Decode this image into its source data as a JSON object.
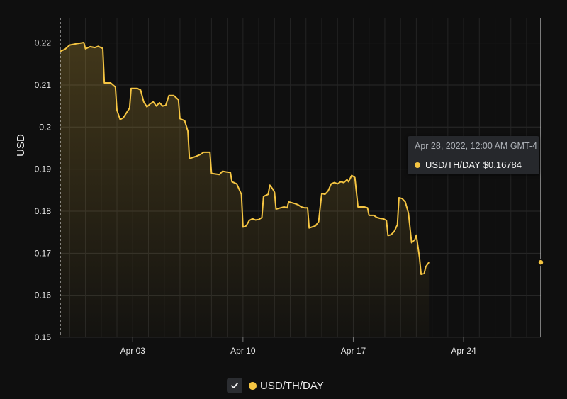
{
  "chart_data": {
    "type": "area",
    "ylabel": "USD",
    "xlabel": "",
    "ylim": [
      0.15,
      0.226
    ],
    "y_ticks": [
      "0.15",
      "0.16",
      "0.17",
      "0.18",
      "0.19",
      "0.2",
      "0.21",
      "0.22"
    ],
    "x_ticks": [
      {
        "label": "Apr 03",
        "x": 6
      },
      {
        "label": "Apr 10",
        "x": 13
      },
      {
        "label": "Apr 17",
        "x": 20
      },
      {
        "label": "Apr 24",
        "x": 27
      }
    ],
    "xlim": [
      1.4,
      31.9
    ],
    "grid": true,
    "series": [
      {
        "name": "USD/TH/DAY",
        "color": "#f5c542",
        "points": [
          [
            1.4,
            0.218
          ],
          [
            1.7,
            0.2185
          ],
          [
            2.0,
            0.2195
          ],
          [
            2.4,
            0.2198
          ],
          [
            2.9,
            0.2201
          ],
          [
            3.0,
            0.2186
          ],
          [
            3.3,
            0.2191
          ],
          [
            3.6,
            0.2189
          ],
          [
            3.8,
            0.2192
          ],
          [
            4.1,
            0.2187
          ],
          [
            4.2,
            0.2105
          ],
          [
            4.6,
            0.2105
          ],
          [
            4.9,
            0.2095
          ],
          [
            5.0,
            0.204
          ],
          [
            5.2,
            0.2018
          ],
          [
            5.4,
            0.2022
          ],
          [
            5.8,
            0.2045
          ],
          [
            5.9,
            0.2092
          ],
          [
            6.3,
            0.2092
          ],
          [
            6.5,
            0.2088
          ],
          [
            6.7,
            0.206
          ],
          [
            6.9,
            0.2048
          ],
          [
            7.1,
            0.2055
          ],
          [
            7.3,
            0.206
          ],
          [
            7.5,
            0.205
          ],
          [
            7.7,
            0.2058
          ],
          [
            7.9,
            0.205
          ],
          [
            8.1,
            0.2052
          ],
          [
            8.3,
            0.2075
          ],
          [
            8.6,
            0.2075
          ],
          [
            8.9,
            0.2065
          ],
          [
            9.0,
            0.202
          ],
          [
            9.3,
            0.2015
          ],
          [
            9.5,
            0.199
          ],
          [
            9.6,
            0.1925
          ],
          [
            10.0,
            0.193
          ],
          [
            10.3,
            0.1935
          ],
          [
            10.5,
            0.194
          ],
          [
            10.9,
            0.194
          ],
          [
            11.0,
            0.189
          ],
          [
            11.5,
            0.1887
          ],
          [
            11.7,
            0.1895
          ],
          [
            12.0,
            0.1893
          ],
          [
            12.2,
            0.1892
          ],
          [
            12.3,
            0.187
          ],
          [
            12.6,
            0.1865
          ],
          [
            12.9,
            0.184
          ],
          [
            13.0,
            0.1762
          ],
          [
            13.2,
            0.1765
          ],
          [
            13.4,
            0.1778
          ],
          [
            13.6,
            0.1782
          ],
          [
            13.8,
            0.1779
          ],
          [
            14.0,
            0.178
          ],
          [
            14.2,
            0.1785
          ],
          [
            14.3,
            0.1835
          ],
          [
            14.6,
            0.184
          ],
          [
            14.7,
            0.1862
          ],
          [
            14.9,
            0.1852
          ],
          [
            15.0,
            0.1845
          ],
          [
            15.1,
            0.1805
          ],
          [
            15.4,
            0.1808
          ],
          [
            15.6,
            0.181
          ],
          [
            15.8,
            0.1808
          ],
          [
            15.9,
            0.1822
          ],
          [
            16.3,
            0.1818
          ],
          [
            16.5,
            0.1815
          ],
          [
            16.7,
            0.181
          ],
          [
            16.9,
            0.1808
          ],
          [
            17.1,
            0.1808
          ],
          [
            17.2,
            0.176
          ],
          [
            17.6,
            0.1765
          ],
          [
            17.7,
            0.177
          ],
          [
            17.8,
            0.1775
          ],
          [
            17.9,
            0.181
          ],
          [
            18.0,
            0.1842
          ],
          [
            18.2,
            0.184
          ],
          [
            18.4,
            0.1848
          ],
          [
            18.6,
            0.1865
          ],
          [
            18.8,
            0.1868
          ],
          [
            19.0,
            0.1865
          ],
          [
            19.2,
            0.187
          ],
          [
            19.4,
            0.1868
          ],
          [
            19.6,
            0.1875
          ],
          [
            19.7,
            0.187
          ],
          [
            19.9,
            0.1885
          ],
          [
            20.1,
            0.188
          ],
          [
            20.2,
            0.1845
          ],
          [
            20.3,
            0.181
          ],
          [
            20.7,
            0.181
          ],
          [
            20.9,
            0.1808
          ],
          [
            21.0,
            0.179
          ],
          [
            21.3,
            0.179
          ],
          [
            21.5,
            0.1785
          ],
          [
            21.7,
            0.1783
          ],
          [
            21.9,
            0.1782
          ],
          [
            22.1,
            0.1778
          ],
          [
            22.2,
            0.1742
          ],
          [
            22.4,
            0.1744
          ],
          [
            22.6,
            0.1752
          ],
          [
            22.8,
            0.1768
          ],
          [
            22.9,
            0.1832
          ],
          [
            23.1,
            0.183
          ],
          [
            23.3,
            0.1822
          ],
          [
            23.5,
            0.1795
          ],
          [
            23.6,
            0.176
          ],
          [
            23.7,
            0.1725
          ],
          [
            23.9,
            0.1732
          ],
          [
            24.0,
            0.1743
          ],
          [
            24.2,
            0.169
          ],
          [
            24.3,
            0.165
          ],
          [
            24.5,
            0.1652
          ],
          [
            24.6,
            0.1668
          ],
          [
            24.8,
            0.16784
          ]
        ]
      }
    ],
    "tooltip": {
      "date": "Apr 28, 2022, 12:00 AM GMT-4",
      "series": "USD/TH/DAY",
      "value": "$0.16784"
    },
    "legend": [
      {
        "label": "USD/TH/DAY",
        "color": "#f5c542",
        "checked": true
      }
    ]
  }
}
